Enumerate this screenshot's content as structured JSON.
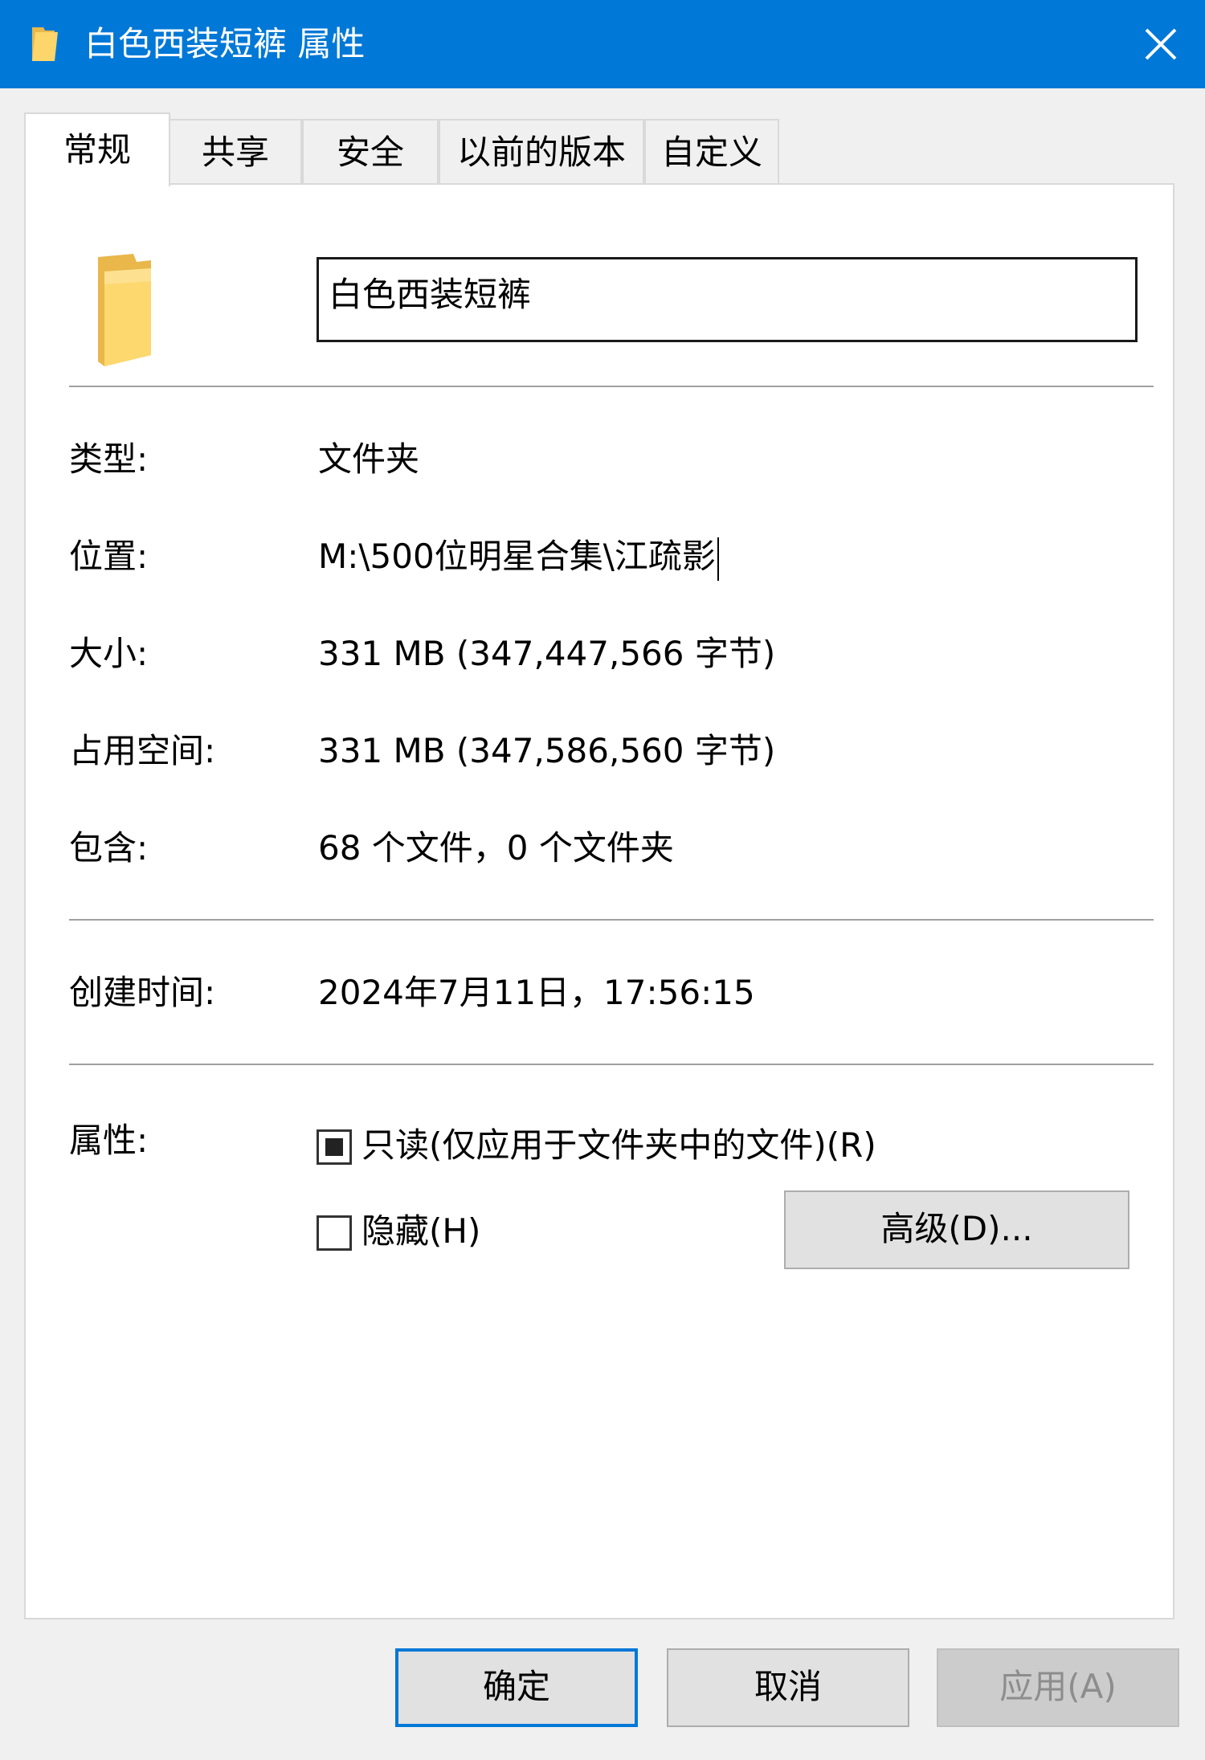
{
  "window": {
    "title": "白色西装短裤 属性",
    "close_icon": "close-icon",
    "title_icon": "folder-icon",
    "accent_color": "#0078d7"
  },
  "tabs": [
    {
      "label": "常规",
      "active": true
    },
    {
      "label": "共享",
      "active": false
    },
    {
      "label": "安全",
      "active": false
    },
    {
      "label": "以前的版本",
      "active": false
    },
    {
      "label": "自定义",
      "active": false
    }
  ],
  "general": {
    "folder_icon": "folder-icon",
    "name_value": "白色西装短裤",
    "rows": [
      {
        "label": "类型:",
        "value": "文件夹"
      },
      {
        "label": "位置:",
        "value": "M:\\500位明星合集\\江疏影"
      },
      {
        "label": "大小:",
        "value": "331 MB (347,447,566 字节)"
      },
      {
        "label": "占用空间:",
        "value": "331 MB (347,586,560 字节)"
      },
      {
        "label": "包含:",
        "value": "68 个文件，0 个文件夹"
      }
    ],
    "created": {
      "label": "创建时间:",
      "value": "2024年7月11日，17:56:15"
    },
    "attributes": {
      "label": "属性:",
      "readonly": {
        "label": "只读(仅应用于文件夹中的文件)(R)",
        "state": "indeterminate"
      },
      "hidden": {
        "label": "隐藏(H)",
        "state": "unchecked"
      },
      "advanced_button": "高级(D)..."
    }
  },
  "footer": {
    "ok": "确定",
    "cancel": "取消",
    "apply": "应用(A)"
  }
}
